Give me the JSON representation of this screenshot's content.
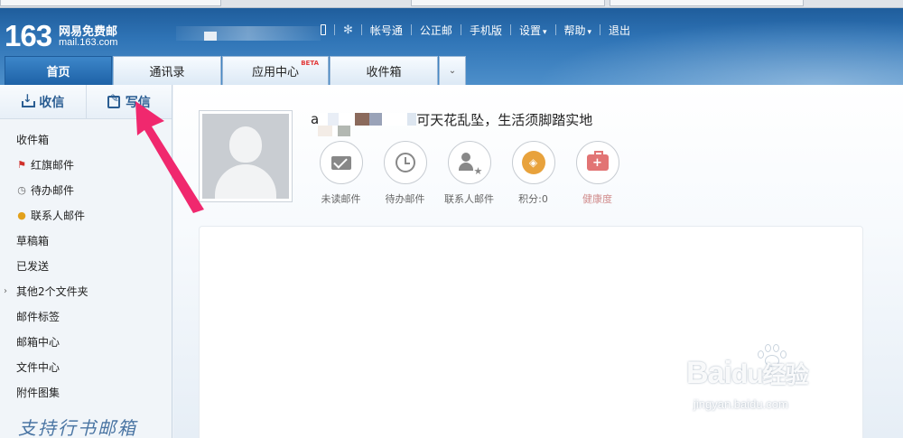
{
  "header": {
    "logo_number": "163",
    "logo_name": "网易免费邮",
    "logo_domain": "mail.163.com",
    "links": [
      {
        "label": "帐号通"
      },
      {
        "label": "公正邮"
      },
      {
        "label": "手机版"
      },
      {
        "label": "设置"
      },
      {
        "label": "帮助"
      },
      {
        "label": "退出"
      }
    ],
    "gradient_top": "#1f5d9c",
    "gradient_bottom": "#4d8fca"
  },
  "tabs": [
    {
      "label": "首页",
      "active": true
    },
    {
      "label": "通讯录",
      "active": false
    },
    {
      "label": "应用中心",
      "badge": "BETA",
      "active": false
    },
    {
      "label": "收件箱",
      "active": false
    }
  ],
  "sidebar": {
    "receive_label": "收信",
    "compose_label": "写信",
    "folders": [
      {
        "label": "收件箱",
        "icon": "none"
      },
      {
        "label": "红旗邮件",
        "icon": "red-flag-icon"
      },
      {
        "label": "待办邮件",
        "icon": "clock-icon"
      },
      {
        "label": "联系人邮件",
        "icon": "person-icon"
      },
      {
        "label": "草稿箱",
        "icon": "none"
      },
      {
        "label": "已发送",
        "icon": "none"
      },
      {
        "label": "其他2个文件夹",
        "icon": "expand-arrow-icon"
      },
      {
        "label": "邮件标签",
        "icon": "none"
      },
      {
        "label": "邮箱中心",
        "icon": "none"
      },
      {
        "label": "文件中心",
        "icon": "none"
      },
      {
        "label": "附件图集",
        "icon": "none"
      }
    ],
    "footer_text": "支持行书邮箱"
  },
  "profile": {
    "name_prefix": "a",
    "motto": "可天花乱坠，生活须脚踏实地",
    "quick_links": [
      {
        "label": "未读邮件",
        "icon": "envelope-icon"
      },
      {
        "label": "待办邮件",
        "icon": "clock-icon"
      },
      {
        "label": "联系人邮件",
        "icon": "contact-star-icon"
      },
      {
        "label": "积分:0",
        "icon": "coin-icon"
      },
      {
        "label": "健康度",
        "icon": "medical-kit-icon"
      }
    ]
  },
  "watermark": {
    "brand": "Bai",
    "brand_cn": "经验",
    "url": "jingyan.baidu.com"
  },
  "colors": {
    "accent": "#1e62a7",
    "annotation_arrow": "#f0286e"
  }
}
